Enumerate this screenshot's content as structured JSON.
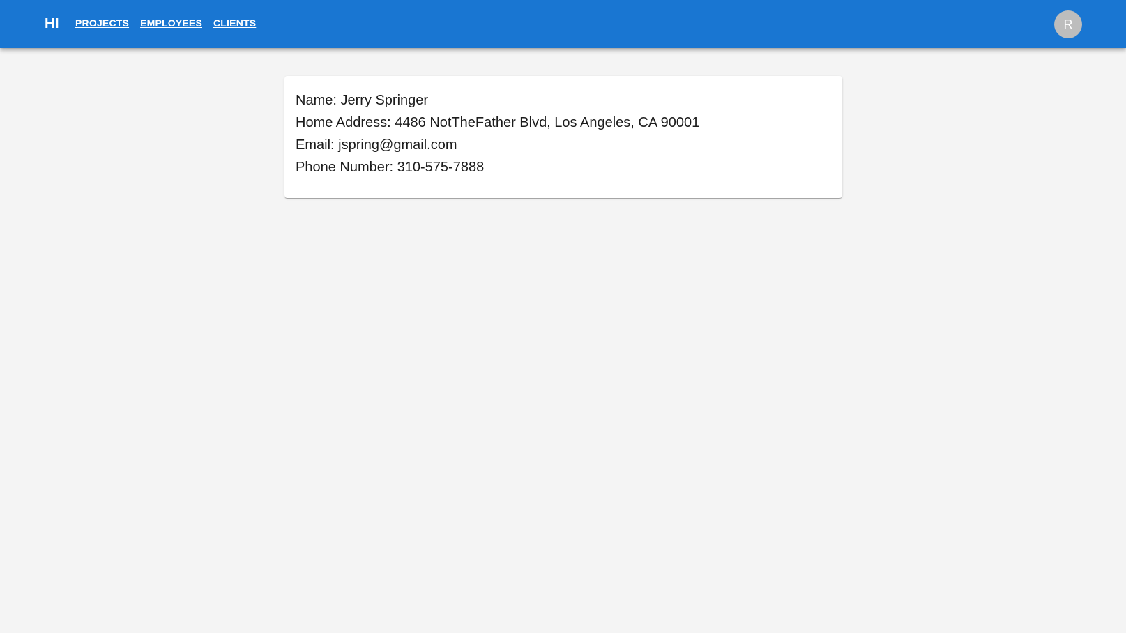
{
  "header": {
    "brand": "HI",
    "nav": [
      {
        "label": "PROJECTS"
      },
      {
        "label": "EMPLOYEES"
      },
      {
        "label": "CLIENTS"
      }
    ],
    "avatar_initial": "R",
    "background_color": "#1976d2"
  },
  "client": {
    "name_line": "Name: Jerry Springer",
    "address_line": "Home Address: 4486 NotTheFather Blvd, Los Angeles, CA 90001",
    "email_line": "Email: jspring@gmail.com",
    "phone_line": "Phone Number: 310-575-7888"
  }
}
